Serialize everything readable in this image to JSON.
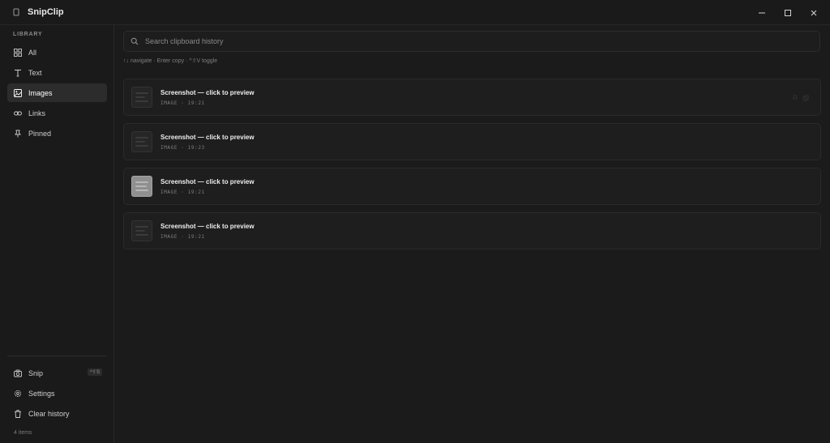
{
  "app": {
    "title": "SnipClip"
  },
  "sidebar": {
    "section_label": "LIBRARY",
    "items": [
      {
        "label": "All",
        "icon": "grid-icon"
      },
      {
        "label": "Text",
        "icon": "text-icon"
      },
      {
        "label": "Images",
        "icon": "image-icon",
        "active": true
      },
      {
        "label": "Links",
        "icon": "link-icon"
      },
      {
        "label": "Pinned",
        "icon": "pin-icon"
      }
    ],
    "bottom": {
      "snip_label": "Snip",
      "snip_shortcut": "^⇧S",
      "settings_label": "Settings",
      "clear_label": "Clear history"
    },
    "count": "4 items"
  },
  "main": {
    "search_placeholder": "Search clipboard history",
    "hint": "↑↓ navigate · Enter copy · ^⇧V toggle",
    "cards": [
      {
        "title": "Screenshot — click to preview",
        "meta": "IMAGE · 19:21",
        "thumb": "dark"
      },
      {
        "title": "Screenshot — click to preview",
        "meta": "IMAGE · 19:23",
        "thumb": "dark"
      },
      {
        "title": "Screenshot — click to preview",
        "meta": "IMAGE · 19:21",
        "thumb": "light"
      },
      {
        "title": "Screenshot — click to preview",
        "meta": "IMAGE · 19:21",
        "thumb": "dark"
      }
    ]
  },
  "colors": {
    "background": "#1b1b1b",
    "sidebar": "#1a1a1a",
    "active_item": "#2c2c2c",
    "card": "#1e1e1e",
    "border": "#2a2a2a"
  }
}
